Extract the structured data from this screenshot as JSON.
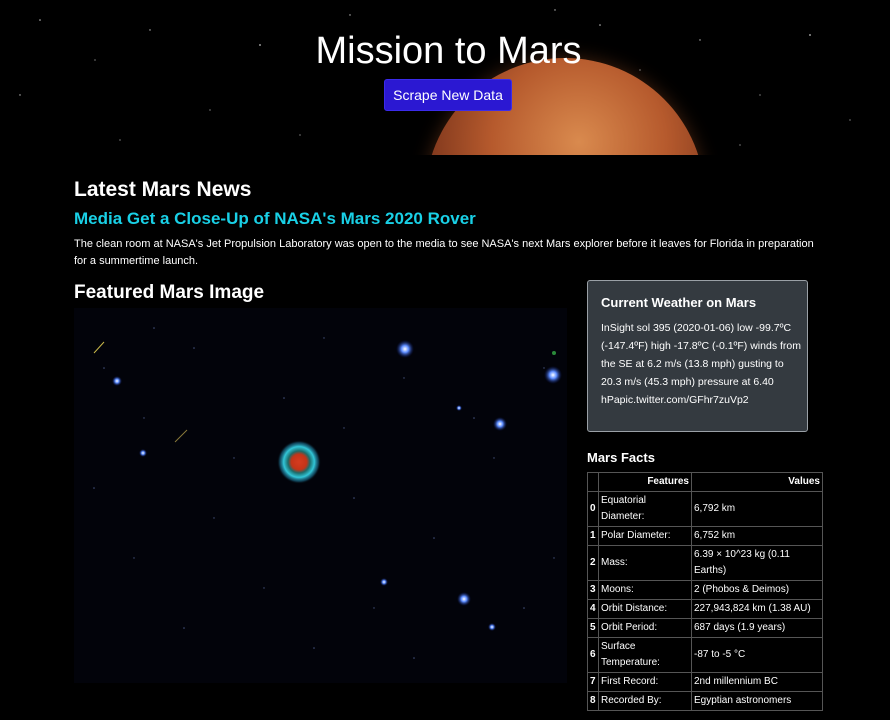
{
  "header": {
    "title": "Mission to Mars",
    "scrape_button_label": "Scrape New Data"
  },
  "news": {
    "heading": "Latest Mars News",
    "title": "Media Get a Close-Up of NASA's Mars 2020 Rover",
    "paragraph": "The clean room at NASA's Jet Propulsion Laboratory was open to the media to see NASA's next Mars explorer before it leaves for Florida in preparation for a summertime launch."
  },
  "featured_image": {
    "heading": "Featured Mars Image"
  },
  "weather": {
    "heading": "Current Weather on Mars",
    "text": "InSight sol 395 (2020-01-06) low -99.7ºC (-147.4ºF) high -17.8ºC (-0.1ºF) winds from the SE at 6.2 m/s (13.8 mph) gusting to 20.3 m/s (45.3 mph) pressure at 6.40 hPapic.twitter.com/GFhr7zuVp2"
  },
  "facts": {
    "heading": "Mars Facts",
    "columns": [
      "",
      "Features",
      "Values"
    ],
    "rows": [
      {
        "index": "0",
        "feature": "Equatorial Diameter:",
        "value": "6,792 km"
      },
      {
        "index": "1",
        "feature": "Polar Diameter:",
        "value": "6,752 km"
      },
      {
        "index": "2",
        "feature": "Mass:",
        "value": "6.39 × 10^23 kg (0.11 Earths)"
      },
      {
        "index": "3",
        "feature": "Moons:",
        "value": "2 (Phobos & Deimos)"
      },
      {
        "index": "4",
        "feature": "Orbit Distance:",
        "value": "227,943,824 km (1.38 AU)"
      },
      {
        "index": "5",
        "feature": "Orbit Period:",
        "value": "687 days (1.9 years)"
      },
      {
        "index": "6",
        "feature": "Surface Temperature:",
        "value": "-87 to -5 °C"
      },
      {
        "index": "7",
        "feature": "First Record:",
        "value": "2nd millennium BC"
      },
      {
        "index": "8",
        "feature": "Recorded By:",
        "value": "Egyptian astronomers"
      }
    ]
  },
  "colors": {
    "button": "#2b18d2",
    "news_title": "#19d0e6",
    "weather_card": "#343a40"
  }
}
